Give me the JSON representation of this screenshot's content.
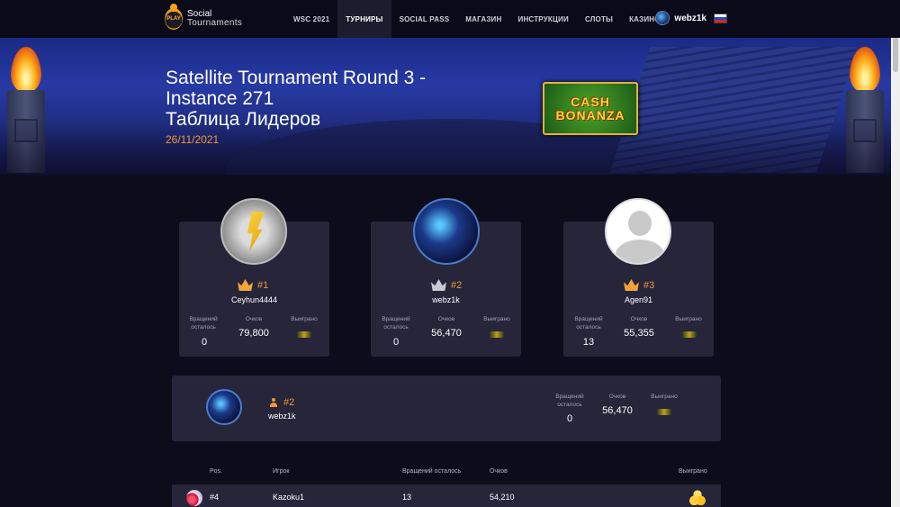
{
  "nav": {
    "logo": {
      "line1": "Social",
      "line2": "Tournaments",
      "mark": "PLAY"
    },
    "items": [
      {
        "label": "WSC 2021",
        "active": false
      },
      {
        "label": "ТУРНИРЫ",
        "active": true
      },
      {
        "label": "SOCIAL PASS",
        "active": false
      },
      {
        "label": "МАГАЗИН",
        "active": false
      },
      {
        "label": "ИНСТРУКЦИИ",
        "active": false
      },
      {
        "label": "СЛОТЫ",
        "active": false
      },
      {
        "label": "КАЗИНО",
        "active": false
      }
    ],
    "user": {
      "name": "webz1k",
      "flag": "russia-flag-icon"
    }
  },
  "banner": {
    "title_line1": "Satellite Tournament Round 3 -",
    "title_line2": "Instance 271",
    "title_line3": "Таблица Лидеров",
    "date": "26/11/2021",
    "game_logo": {
      "line1": "CASH",
      "line2": "BONANZA"
    }
  },
  "labels": {
    "spins_left_1": "Вращений",
    "spins_left_2": "осталось",
    "points": "Очков",
    "won": "Выиграно"
  },
  "podium": [
    {
      "rank": "#1",
      "name": "Ceyhun4444",
      "spins": "0",
      "points": "79,800",
      "avatar": "gold-bolt-avatar"
    },
    {
      "rank": "#2",
      "name": "webz1k",
      "spins": "0",
      "points": "56,470",
      "avatar": "wizard-avatar"
    },
    {
      "rank": "#3",
      "name": "Agen91",
      "spins": "13",
      "points": "55,355",
      "avatar": "default-avatar"
    }
  ],
  "me": {
    "rank": "#2",
    "name": "webz1k",
    "spins": "0",
    "points": "56,470"
  },
  "table": {
    "headers": {
      "pos": "Pos.",
      "player": "Игрок",
      "spins": "Вращений осталось",
      "points": "Очков",
      "won": "Выиграно"
    },
    "rows": [
      {
        "pos": "#4",
        "player": "Kazoku1",
        "spins": "13",
        "points": "54,210"
      }
    ]
  },
  "colors": {
    "accent": "#f1993a",
    "card": "#26253a",
    "bg": "#0d0c1a"
  }
}
